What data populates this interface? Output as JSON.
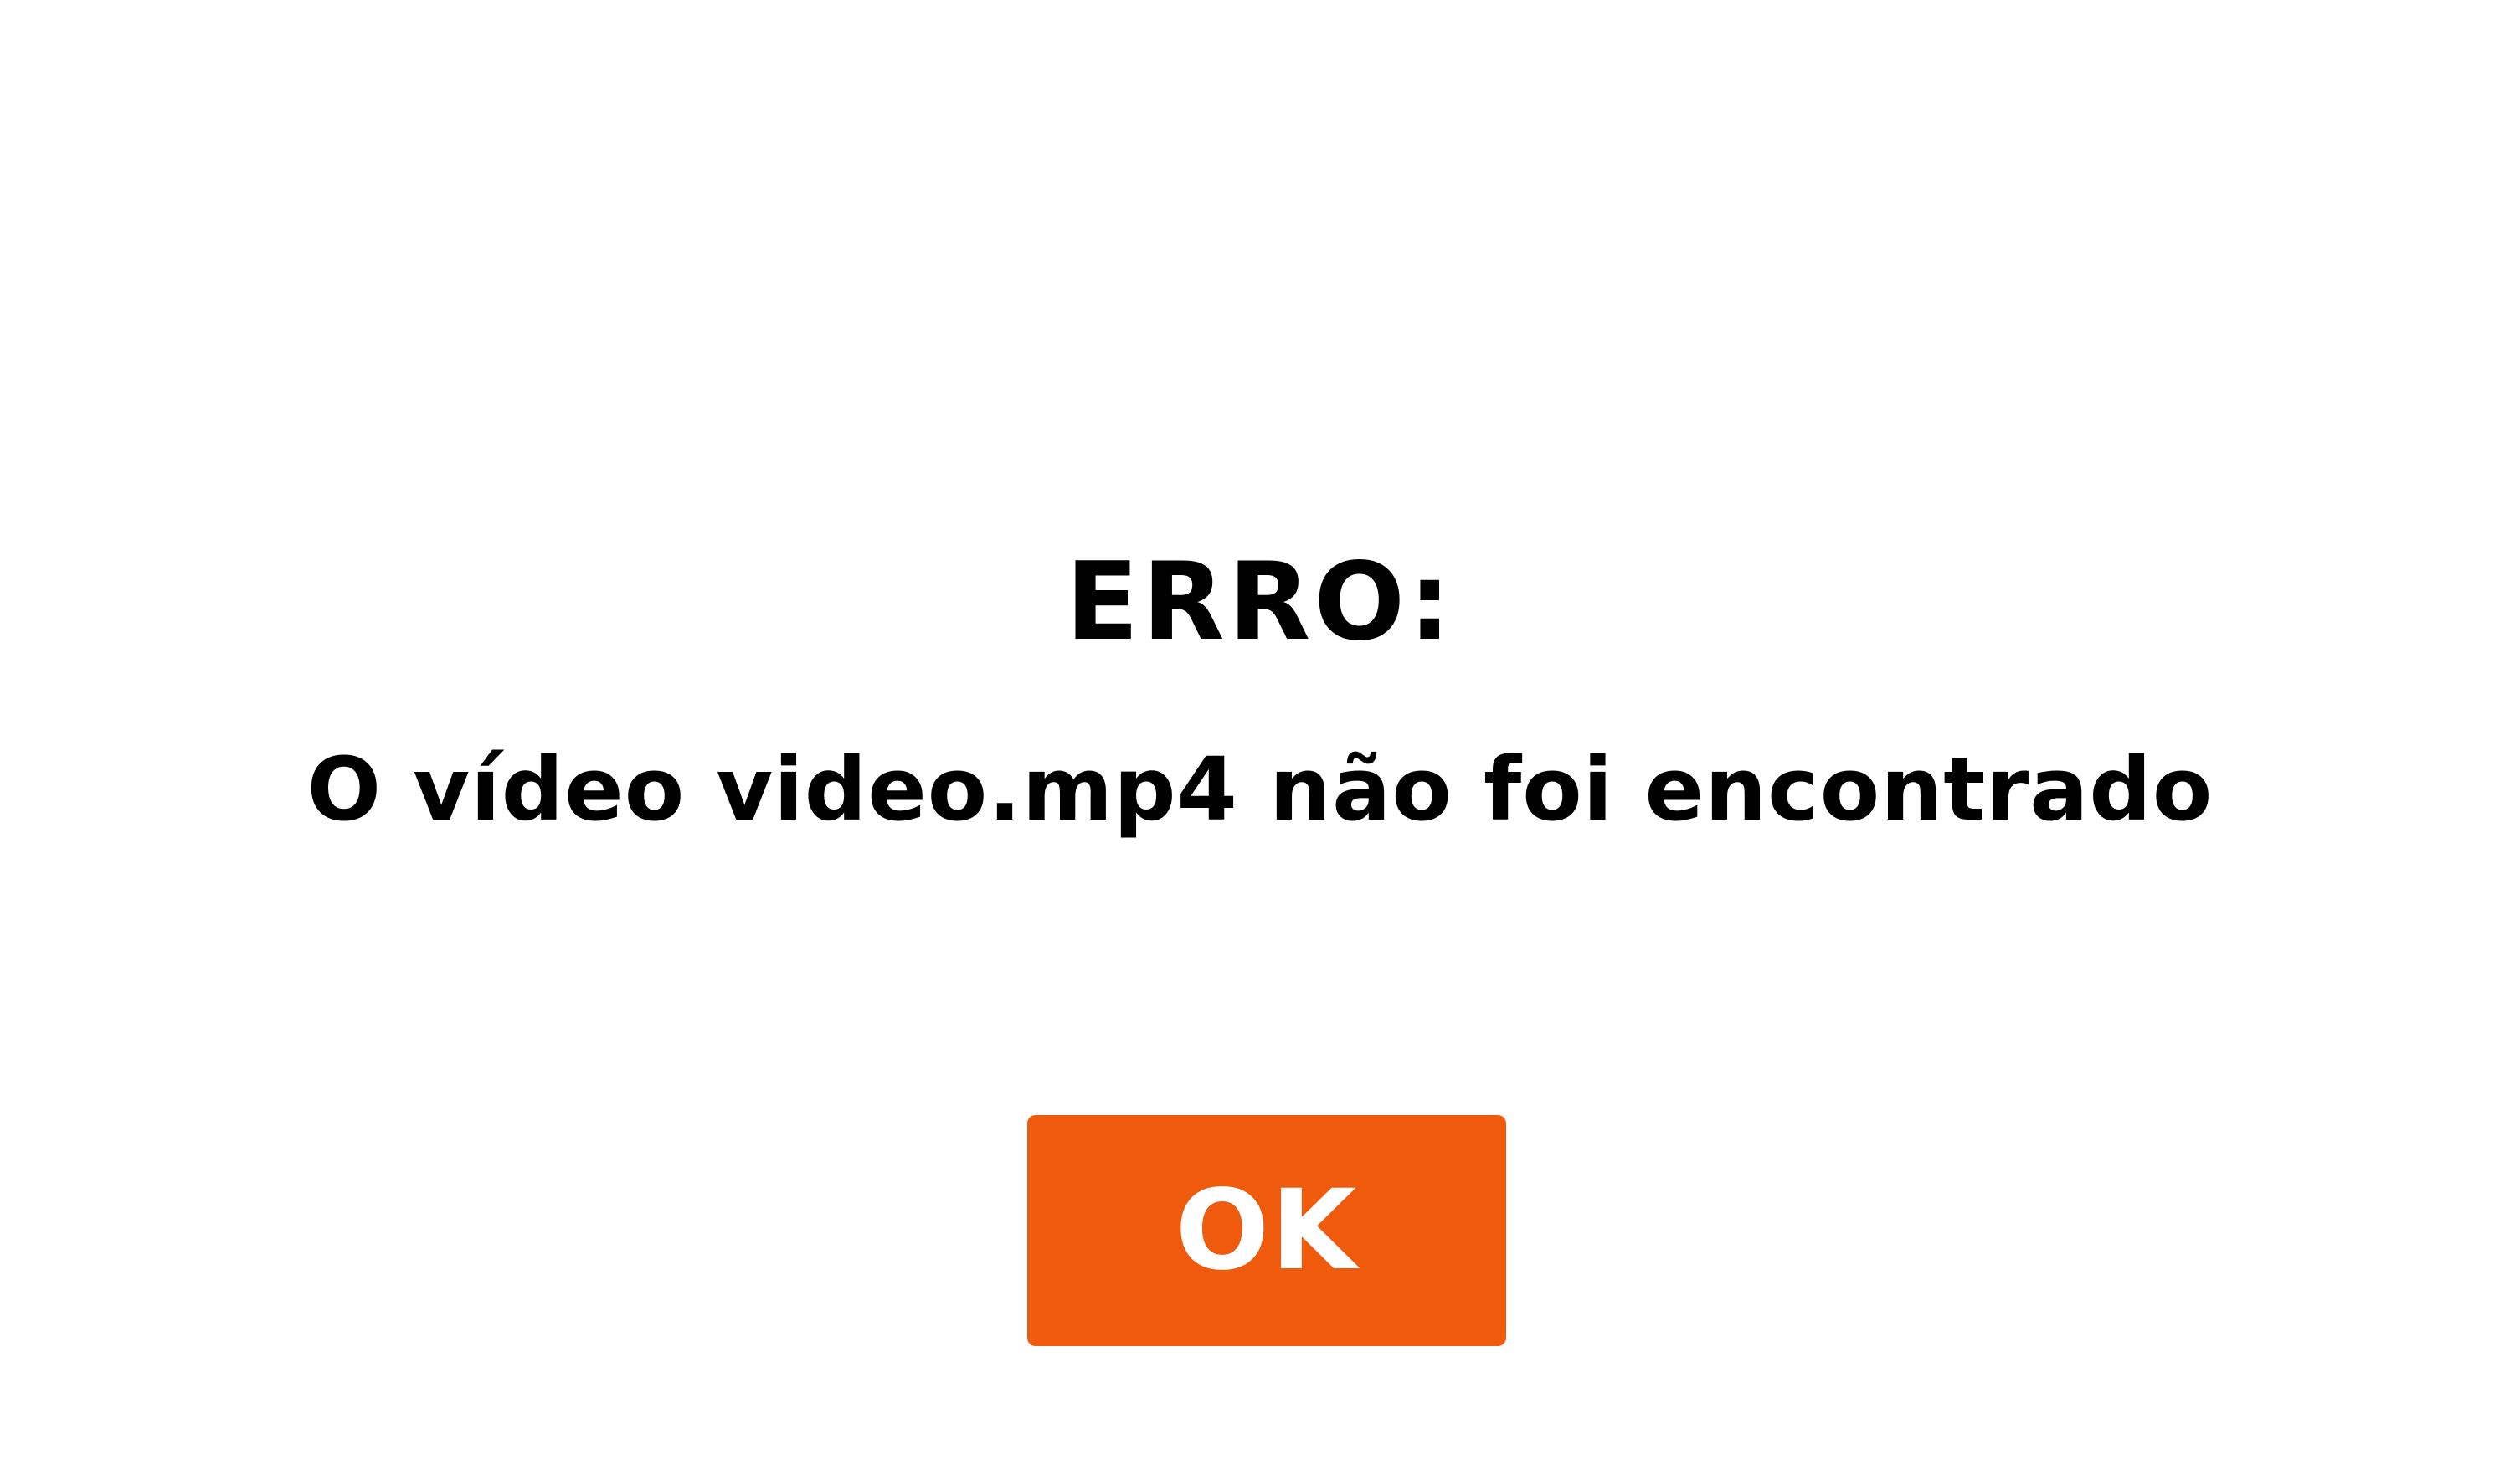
{
  "dialog": {
    "title": "ERRO:",
    "message": "O vídeo video.mp4 não foi encontrado",
    "ok_label": "OK"
  },
  "colors": {
    "background": "#ffffff",
    "text": "#000000",
    "button": "#f05a0c",
    "button_text": "#ffffff"
  }
}
